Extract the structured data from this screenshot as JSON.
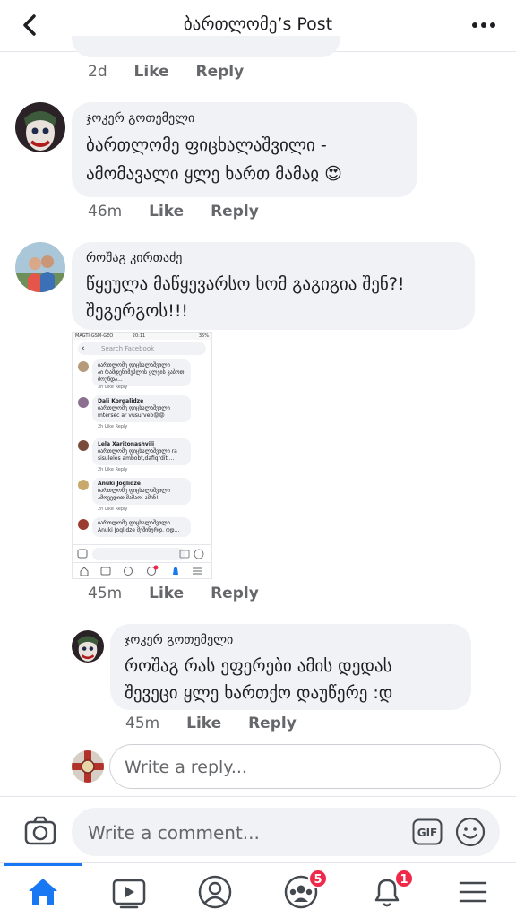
{
  "header": {
    "title": "ბართლომე’s Post"
  },
  "prev_comment": {
    "time": "2d",
    "like": "Like",
    "reply": "Reply"
  },
  "comments": [
    {
      "name": "ჯოკერ გოთემელი",
      "text_lines": [
        "ბართლომე ფიცხალაშვილი -",
        "ამომავალი ყლე ხართ მამაჲ 😍"
      ],
      "time": "46m",
      "like": "Like",
      "reply": "Reply"
    },
    {
      "name": "როშაგ კირთაძე",
      "text_lines": [
        "წყეულა მაწყევარსო ხომ გაგიგია შენ?!",
        "შეგერგოს!!!"
      ],
      "time": "45m",
      "like": "Like",
      "reply": "Reply"
    }
  ],
  "screenshot_attachment": {
    "status_left": "MAGTI-GSM-GEO",
    "status_time": "20:11",
    "status_right": "35%",
    "search_placeholder": "Search Facebook",
    "items": [
      {
        "name": "ბართლომე ფიცხალაშვილი",
        "text": "აი რამდენიმეპლის ყლეის კაბოთ მოუნდა...",
        "meta": "3h  Like  Reply"
      },
      {
        "name": "Dali Korgalidze",
        "text": "ბართლომე ფიცხალაშვილი mtersec ar vusurveb😡😡",
        "meta": "2h  Like  Reply"
      },
      {
        "name": "Lela Xaritonashvili",
        "text": "ბართლომე ფიცხალაშვილი ra sisuleles ambobt,dafiqrdit....",
        "meta": "2h  Like  Reply"
      },
      {
        "name": "Anuki Joglidze",
        "text": "ბართლომე ფიცხალაშვილი ამოვედით მამაო. ამინ!",
        "meta": "2h  Like  Reply"
      },
      {
        "name": "ბართლომე ფიცხალაშვილი",
        "text": "Anuki Joglidze მეშინერდ. ოდ...",
        "meta": ""
      }
    ]
  },
  "nested_reply": {
    "name": "ჯოკერ გოთემელი",
    "text_lines": [
      "როშაგ რას ეფერები ამის დედას",
      "შევეცი ყლე ხართქო დაუწერე :დ"
    ],
    "time": "45m",
    "like": "Like",
    "reply": "Reply"
  },
  "reply_input": {
    "placeholder": "Write a reply..."
  },
  "composer": {
    "placeholder": "Write a comment...",
    "gif_label": "GIF"
  },
  "tabbar": {
    "badges": {
      "groups": "5",
      "notifications": "1"
    },
    "active": "home",
    "accent": "#1877f2"
  }
}
